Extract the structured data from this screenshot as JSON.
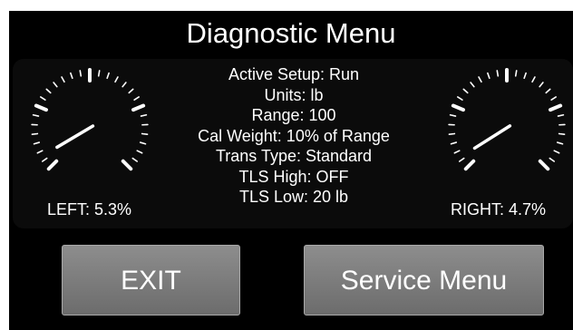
{
  "header": {
    "title": "Diagnostic Menu"
  },
  "gauges": {
    "left": {
      "label": "LEFT:",
      "value_text": "5.3%",
      "percent": 5.3
    },
    "right": {
      "label": "RIGHT:",
      "value_text": "4.7%",
      "percent": 4.7
    }
  },
  "info": {
    "lines": [
      "Active Setup: Run",
      "Units: lb",
      "Range: 100",
      "Cal Weight: 10% of Range",
      "Trans Type: Standard",
      "TLS High: OFF",
      "TLS Low: 20 lb"
    ]
  },
  "buttons": {
    "exit_label": "EXIT",
    "service_label": "Service Menu"
  },
  "colors": {
    "background": "#000000",
    "text": "#ffffff",
    "button": "#7b7b7b"
  }
}
